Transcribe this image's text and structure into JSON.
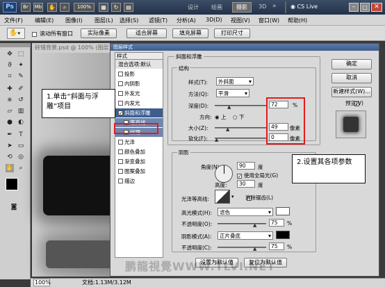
{
  "titlebar": {
    "logo": "Ps",
    "icon_labels": [
      "Br",
      "Mb"
    ],
    "zoom": "100%",
    "workspaces": [
      "设计",
      "绘画",
      "摄影",
      "3D"
    ],
    "more": "»",
    "cs_live": "CS Live"
  },
  "menu": [
    "文件(F)",
    "编辑(E)",
    "图像(I)",
    "图层(L)",
    "选择(S)",
    "滤镜(T)",
    "分析(A)",
    "3D(D)",
    "视图(V)",
    "窗口(W)",
    "帮助(H)"
  ],
  "options": {
    "scroll_all": "滚动所有窗口",
    "buttons": [
      "实际像素",
      "适合屏幕",
      "填充屏幕",
      "打印尺寸"
    ]
  },
  "document": {
    "tab": "砖错背景.psd @ 100% (图层"
  },
  "status": {
    "zoom": "100%",
    "doc": "文档:1.13M/3.12M"
  },
  "watermark": "鹏龍視覺WWW.TLVI.NET",
  "dialog": {
    "title": "图层样式",
    "styles_header": "样式",
    "blend_header": "混合选项:默认",
    "styles": [
      {
        "label": "投影",
        "checked": false
      },
      {
        "label": "内阴影",
        "checked": false
      },
      {
        "label": "外发光",
        "checked": false
      },
      {
        "label": "内发光",
        "checked": false
      },
      {
        "label": "斜面和浮雕",
        "checked": true,
        "selected": true
      },
      {
        "label": "等高线",
        "checked": false,
        "sub": true
      },
      {
        "label": "纹理",
        "checked": false,
        "sub": true
      },
      {
        "label": "光泽",
        "checked": false
      },
      {
        "label": "颜色叠加",
        "checked": false
      },
      {
        "label": "渐变叠加",
        "checked": false
      },
      {
        "label": "图案叠加",
        "checked": false
      },
      {
        "label": "描边",
        "checked": false
      }
    ],
    "bevel": {
      "title": "斜面和浮雕",
      "structure": "结构",
      "style_label": "样式(T):",
      "style_value": "外斜面",
      "technique_label": "方法(Q):",
      "technique_value": "平滑",
      "depth_label": "深度(D):",
      "depth_value": "72",
      "depth_unit": "%",
      "direction_label": "方向:",
      "dir_up": "上",
      "dir_down": "下",
      "size_label": "大小(Z):",
      "size_value": "49",
      "size_unit": "像素",
      "soften_label": "软化(F):",
      "soften_value": "0",
      "soften_unit": "像素"
    },
    "shading": {
      "title": "阴影",
      "angle_label": "角度(N):",
      "angle_value": "90",
      "angle_unit": "度",
      "global_light": "使用全局光(G)",
      "altitude_label": "高度:",
      "altitude_value": "30",
      "altitude_unit": "度",
      "gloss_label": "光泽等高线:",
      "anti_alias": "消除锯齿(L)",
      "highlight_label": "高光模式(H):",
      "highlight_value": "滤色",
      "highlight_opacity_label": "不透明度(O):",
      "highlight_opacity": "75",
      "pct": "%",
      "shadow_label": "阴影模式(A):",
      "shadow_value": "正片叠底",
      "shadow_opacity_label": "不透明度(C):",
      "shadow_opacity": "75"
    },
    "buttons": {
      "ok": "确定",
      "cancel": "取消",
      "new_style": "新建样式(W)...",
      "preview": "预览(V)"
    },
    "default_buttons": [
      "设置为默认值",
      "复位为默认值"
    ]
  },
  "callouts": {
    "one": "1.单击“斜面与浮雕”项目",
    "two": "2.设置其各项参数"
  },
  "colors": {
    "highlight": "#ffffff",
    "shadow": "#000000",
    "accent": "#e21b1b"
  }
}
